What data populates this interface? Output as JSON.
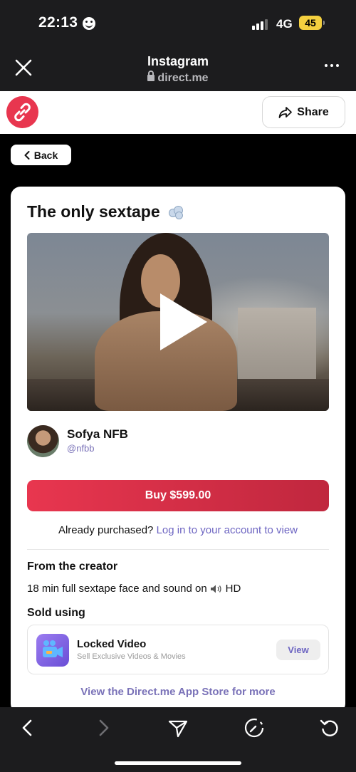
{
  "status_bar": {
    "time": "22:13",
    "network": "4G",
    "battery": "45"
  },
  "browser": {
    "title": "Instagram",
    "url": "direct.me",
    "close_icon": "close-icon",
    "more_icon": "more-icon"
  },
  "topbar": {
    "logo_icon": "link-icon",
    "share_label": "Share",
    "share_icon": "share-icon"
  },
  "back_label": "Back",
  "product": {
    "title": "The only sextape",
    "title_emoji_icon": "dash-cloud-icon",
    "creator_name": "Sofya NFB",
    "creator_handle": "@nfbb",
    "buy_label": "Buy $599.00",
    "purchased_text": "Already purchased?",
    "login_link": "Log in to your account to view"
  },
  "from_creator": {
    "heading": "From the creator",
    "description_before": "18 min full sextape face and sound on",
    "description_after": "HD"
  },
  "sold_using": {
    "heading": "Sold using",
    "app_name": "Locked Video",
    "app_subtitle": "Sell Exclusive Videos & Movies",
    "view_label": "View",
    "store_link": "View the Direct.me App Store for more"
  },
  "colors": {
    "accent": "#e8364f",
    "link": "#6d65c2",
    "chrome": "#1c1c1e"
  }
}
